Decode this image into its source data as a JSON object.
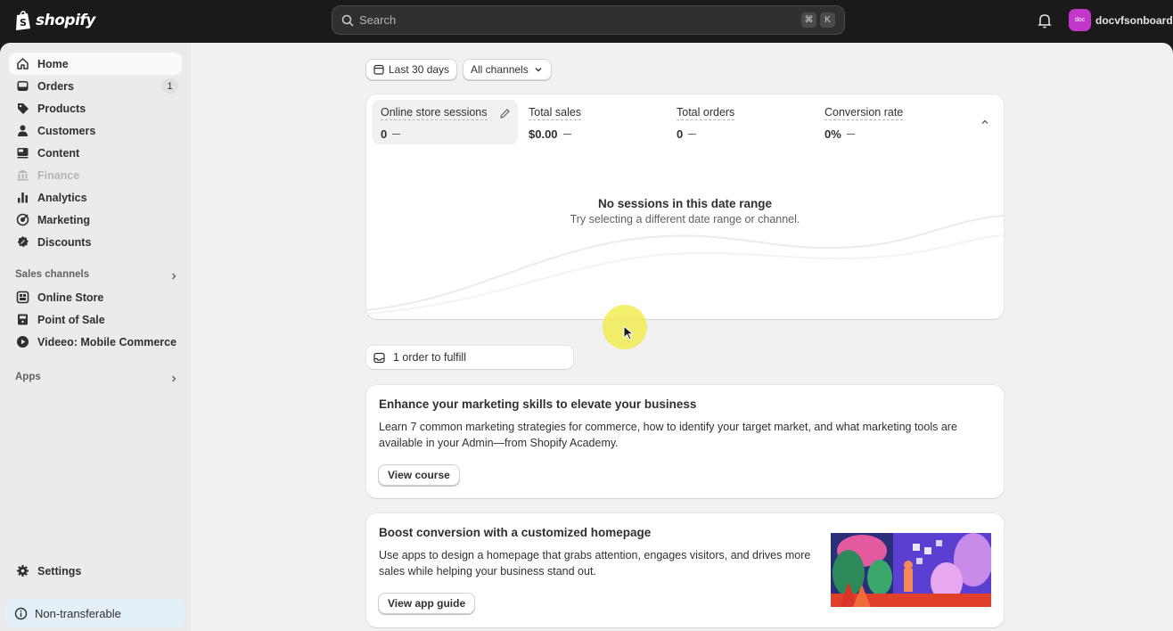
{
  "topbar": {
    "logo_text": "shopify",
    "search_placeholder": "Search",
    "shortcut_keys": [
      "⌘",
      "K"
    ],
    "avatar_text": "doc",
    "account_name": "docvfsonboard"
  },
  "sidebar": {
    "items": [
      {
        "label": "Home",
        "icon": "home-icon"
      },
      {
        "label": "Orders",
        "icon": "inbox-icon",
        "badge": "1"
      },
      {
        "label": "Products",
        "icon": "tag-icon"
      },
      {
        "label": "Customers",
        "icon": "person-icon"
      },
      {
        "label": "Content",
        "icon": "content-icon"
      },
      {
        "label": "Finance",
        "icon": "bank-icon"
      },
      {
        "label": "Analytics",
        "icon": "bar-chart-icon"
      },
      {
        "label": "Marketing",
        "icon": "target-icon"
      },
      {
        "label": "Discounts",
        "icon": "discount-icon"
      }
    ],
    "sales_channels_label": "Sales channels",
    "channels": [
      {
        "label": "Online Store",
        "icon": "store-icon"
      },
      {
        "label": "Point of Sale",
        "icon": "pos-icon"
      },
      {
        "label": "Videeo: Mobile Commerce",
        "icon": "play-icon"
      }
    ],
    "apps_label": "Apps",
    "settings_label": "Settings",
    "non_transferable_label": "Non-transferable"
  },
  "filters": {
    "date_range": "Last 30 days",
    "channel": "All channels"
  },
  "metrics": [
    {
      "label": "Online store sessions",
      "value": "0"
    },
    {
      "label": "Total sales",
      "value": "$0.00"
    },
    {
      "label": "Total orders",
      "value": "0"
    },
    {
      "label": "Conversion rate",
      "value": "0%"
    }
  ],
  "empty_state": {
    "title": "No sessions in this date range",
    "subtitle": "Try selecting a different date range or channel."
  },
  "fulfill": {
    "label": "1 order to fulfill"
  },
  "cards": [
    {
      "title": "Enhance your marketing skills to elevate your business",
      "body": "Learn 7 common marketing strategies for commerce, how to identify your target market, and what marketing tools are available in your Admin—from Shopify Academy.",
      "button": "View course"
    },
    {
      "title": "Boost conversion with a customized homepage",
      "body": "Use apps to design a homepage that grabs attention, engages visitors, and drives more sales while helping your business stand out.",
      "button": "View app guide"
    }
  ],
  "colors": {
    "topbar": "#1a1a1a",
    "avatar": "#c137c9",
    "info_banner": "#e3f0f8"
  }
}
